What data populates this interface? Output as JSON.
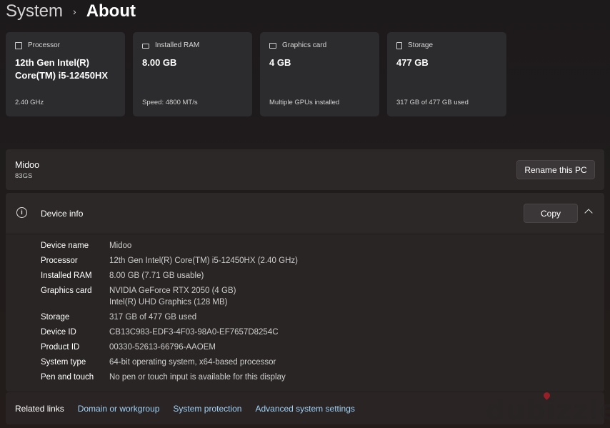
{
  "breadcrumb": {
    "parent": "System",
    "separator": "›",
    "current": "About"
  },
  "cards": [
    {
      "icon": "processor-icon",
      "label": "Processor",
      "value": "12th Gen Intel(R) Core(TM) i5-12450HX",
      "sub": "2.40 GHz"
    },
    {
      "icon": "ram-icon",
      "label": "Installed RAM",
      "value": "8.00 GB",
      "sub": "Speed: 4800 MT/s"
    },
    {
      "icon": "graphics-card-icon",
      "label": "Graphics card",
      "value": "4 GB",
      "sub": "Multiple GPUs installed"
    },
    {
      "icon": "storage-icon",
      "label": "Storage",
      "value": "477 GB",
      "sub": "317 GB of 477 GB used"
    }
  ],
  "pc": {
    "name": "Midoo",
    "model": "83GS",
    "rename_label": "Rename this PC"
  },
  "device_info": {
    "title": "Device info",
    "copy_label": "Copy",
    "specs": [
      {
        "label": "Device name",
        "value": "Midoo"
      },
      {
        "label": "Processor",
        "value": "12th Gen Intel(R) Core(TM) i5-12450HX (2.40 GHz)"
      },
      {
        "label": "Installed RAM",
        "value": "8.00 GB (7.71 GB usable)"
      },
      {
        "label": "Graphics card",
        "value": "NVIDIA GeForce RTX 2050 (4 GB)",
        "value2": "Intel(R) UHD Graphics (128 MB)"
      },
      {
        "label": "Storage",
        "value": "317 GB of 477 GB used"
      },
      {
        "label": "Device ID",
        "value": "CB13C983-EDF3-4F03-98A0-EF7657D8254C"
      },
      {
        "label": "Product ID",
        "value": "00330-52613-66796-AAOEM"
      },
      {
        "label": "System type",
        "value": "64-bit operating system, x64-based processor"
      },
      {
        "label": "Pen and touch",
        "value": "No pen or touch input is available for this display"
      }
    ]
  },
  "related_links": {
    "label": "Related links",
    "links": [
      "Domain or workgroup",
      "System protection",
      "Advanced system settings"
    ]
  },
  "watermark": "dubizzle",
  "colors": {
    "accent_link": "#9fd0f5",
    "card_bg": "#2c2b2d",
    "panel_bg": "#2a2525"
  }
}
